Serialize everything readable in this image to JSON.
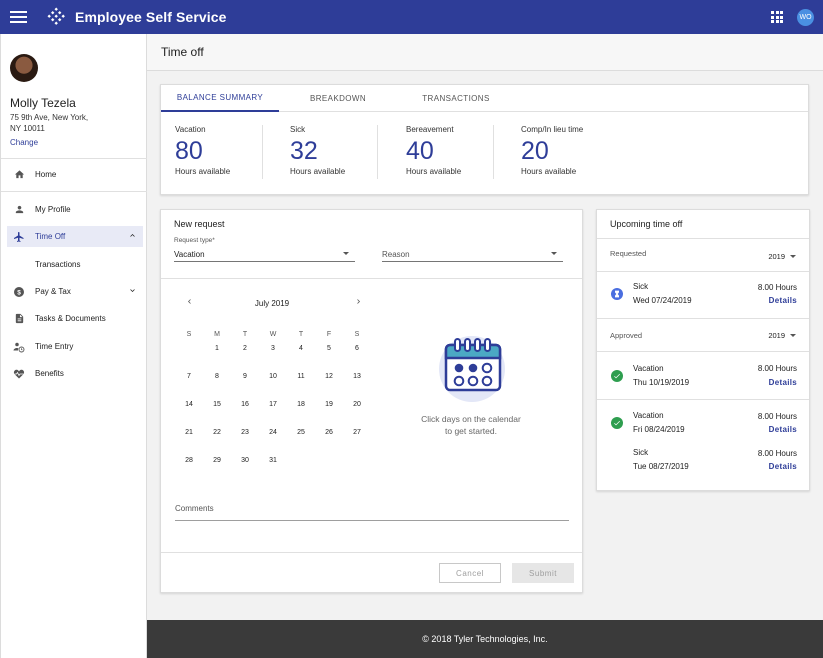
{
  "app": {
    "title": "Employee Self Service",
    "user_initials": "WO"
  },
  "profile": {
    "name": "Molly Tezela",
    "address_line1": "75 9th Ave, New York,",
    "address_line2": "NY 10011",
    "change_label": "Change"
  },
  "sidebar": {
    "items": [
      {
        "label": "Home"
      },
      {
        "label": "My Profile"
      },
      {
        "label": "Time Off"
      },
      {
        "label": "Transactions"
      },
      {
        "label": "Pay & Tax"
      },
      {
        "label": "Tasks & Documents"
      },
      {
        "label": "Time Entry"
      },
      {
        "label": "Benefits"
      }
    ]
  },
  "page": {
    "title": "Time off"
  },
  "balance": {
    "tabs": [
      "BALANCE SUMMARY",
      "BREAKDOWN",
      "TRANSACTIONS"
    ],
    "items": [
      {
        "label": "Vacation",
        "value": "80",
        "sub": "Hours available"
      },
      {
        "label": "Sick",
        "value": "32",
        "sub": "Hours available"
      },
      {
        "label": "Bereavement",
        "value": "40",
        "sub": "Hours available"
      },
      {
        "label": "Comp/In lieu time",
        "value": "20",
        "sub": "Hours available"
      }
    ]
  },
  "request": {
    "title": "New request",
    "type_label": "Request type*",
    "type_value": "Vacation",
    "reason_value": "Reason",
    "calendar": {
      "month": "July 2019",
      "dow": [
        "S",
        "M",
        "T",
        "W",
        "T",
        "F",
        "S"
      ],
      "days": [
        [
          "",
          "1",
          "2",
          "3",
          "4",
          "5",
          "6"
        ],
        [
          "7",
          "8",
          "9",
          "10",
          "11",
          "12",
          "13"
        ],
        [
          "14",
          "15",
          "16",
          "17",
          "18",
          "19",
          "20"
        ],
        [
          "21",
          "22",
          "23",
          "24",
          "25",
          "26",
          "27"
        ],
        [
          "28",
          "29",
          "30",
          "31",
          "",
          "",
          ""
        ]
      ]
    },
    "hint_line1": "Click days on the calendar",
    "hint_line2": "to get started.",
    "comments_label": "Comments",
    "cancel_label": "Cancel",
    "submit_label": "Submit"
  },
  "upcoming": {
    "title": "Upcoming time off",
    "requested_label": "Requested",
    "requested_year": "2019",
    "requested": [
      {
        "type": "Sick",
        "date": "Wed 07/24/2019",
        "hours": "8.00 Hours",
        "details": "Details"
      }
    ],
    "approved_label": "Approved",
    "approved_year": "2019",
    "approved": [
      {
        "type": "Vacation",
        "date": "Thu 10/19/2019",
        "hours": "8.00 Hours",
        "details": "Details"
      },
      {
        "type": "Vacation",
        "date": "Fri 08/24/2019",
        "hours": "8.00 Hours",
        "details": "Details"
      },
      {
        "type": "Sick",
        "date": "Tue 08/27/2019",
        "hours": "8.00 Hours",
        "details": "Details"
      }
    ]
  },
  "footer": {
    "text": "© 2018 Tyler Technologies, Inc."
  },
  "colors": {
    "primary": "#2e3d98",
    "success": "#2e9e4f",
    "pending": "#4a6ee0",
    "footer": "#3a3a3a"
  }
}
